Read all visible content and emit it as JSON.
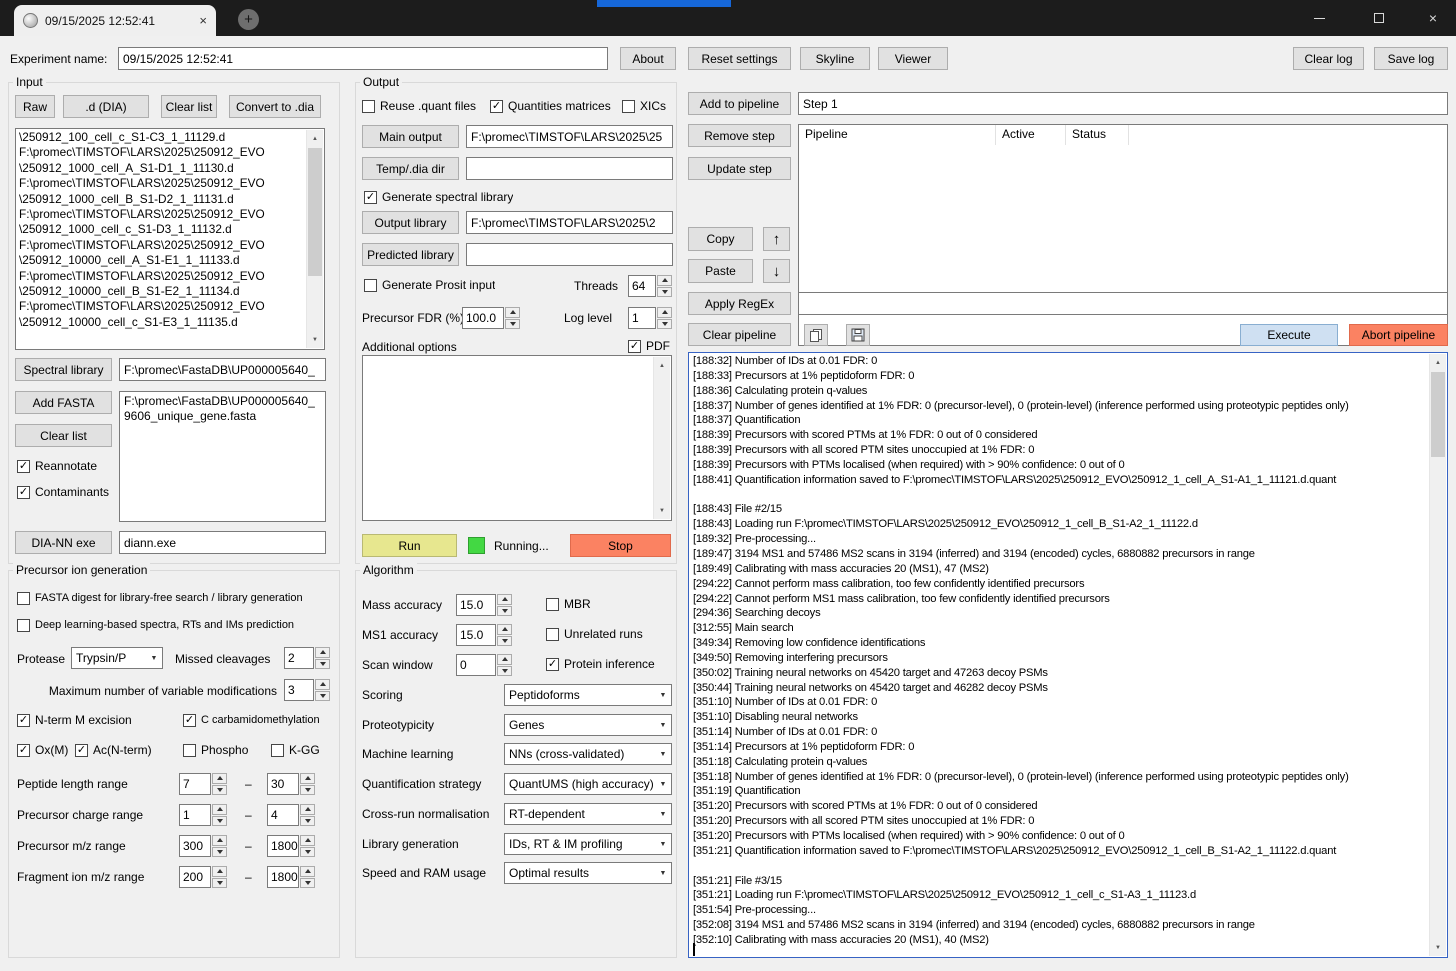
{
  "icons": {
    "dropdown": "▼",
    "check": "✓",
    "plus": "+",
    "close": "×",
    "scroll_up": "▲",
    "scroll_down": "▼",
    "up_arrow": "↑",
    "down_arrow": "↓"
  },
  "colors": {
    "accent_strip": "#1667d9",
    "run_button": "#e7e78f",
    "stop_button": "#fb8262",
    "abort_button": "#fb8262",
    "execute_button": "#cfe0f2",
    "running_indicator": "#43d843",
    "log_focus_border": "#3763c4"
  },
  "titlebar": {
    "tab_title": "09/15/2025 12:52:41"
  },
  "header": {
    "experiment_label": "Experiment name:",
    "experiment_value": "09/15/2025 12:52:41",
    "about": "About",
    "reset_settings": "Reset settings",
    "skyline": "Skyline",
    "viewer": "Viewer",
    "clear_log": "Clear log",
    "save_log": "Save log"
  },
  "input_panel": {
    "title": "Input",
    "raw_btn": "Raw",
    "dia_btn": ".d (DIA)",
    "clear_list_btn": "Clear list",
    "convert_btn": "Convert to .dia",
    "file_lines": [
      "\\250912_100_cell_c_S1-C3_1_11129.d",
      "F:\\promec\\TIMSTOF\\LARS\\2025\\250912_EVO",
      "\\250912_1000_cell_A_S1-D1_1_11130.d",
      "F:\\promec\\TIMSTOF\\LARS\\2025\\250912_EVO",
      "\\250912_1000_cell_B_S1-D2_1_11131.d",
      "F:\\promec\\TIMSTOF\\LARS\\2025\\250912_EVO",
      "\\250912_1000_cell_c_S1-D3_1_11132.d",
      "F:\\promec\\TIMSTOF\\LARS\\2025\\250912_EVO",
      "\\250912_10000_cell_A_S1-E1_1_11133.d",
      "F:\\promec\\TIMSTOF\\LARS\\2025\\250912_EVO",
      "\\250912_10000_cell_B_S1-E2_1_11134.d",
      "F:\\promec\\TIMSTOF\\LARS\\2025\\250912_EVO",
      "\\250912_10000_cell_c_S1-E3_1_11135.d"
    ],
    "spectral_library_btn": "Spectral library",
    "spectral_library_path": "F:\\promec\\FastaDB\\UP000005640_",
    "add_fasta_btn": "Add FASTA",
    "fasta_text": "F:\\promec\\FastaDB\\UP000005640_9606_unique_gene.fasta",
    "clear_fasta_btn": "Clear list",
    "reannotate": {
      "label": "Reannotate",
      "checked": true
    },
    "contaminants": {
      "label": "Contaminants",
      "checked": true
    },
    "diann_exe_btn": "DIA-NN exe",
    "diann_exe_value": "diann.exe"
  },
  "precursor_panel": {
    "title": "Precursor ion generation",
    "fasta_digest": {
      "label": "FASTA digest for library-free search / library generation",
      "checked": false
    },
    "deep_learning": {
      "label": "Deep learning-based spectra, RTs and IMs prediction",
      "checked": false
    },
    "protease_label": "Protease",
    "protease_value": "Trypsin/P",
    "missed_cleavages_label": "Missed cleavages",
    "missed_cleavages_value": "2",
    "max_var_mods_label": "Maximum number of variable modifications",
    "max_var_mods_value": "3",
    "nterm_m": {
      "label": "N-term M excision",
      "checked": true
    },
    "carbamido": {
      "label": "C carbamidomethylation",
      "checked": true
    },
    "oxm": {
      "label": "Ox(M)",
      "checked": true
    },
    "acnterm": {
      "label": "Ac(N-term)",
      "checked": true
    },
    "phospho": {
      "label": "Phospho",
      "checked": false
    },
    "kgg": {
      "label": "K-GG",
      "checked": false
    },
    "dash": "–",
    "peptide_len": {
      "label": "Peptide length range",
      "from": "7",
      "to": "30"
    },
    "charge": {
      "label": "Precursor charge range",
      "from": "1",
      "to": "4"
    },
    "mz": {
      "label": "Precursor m/z range",
      "from": "300",
      "to": "1800"
    },
    "fragment_mz": {
      "label": "Fragment ion m/z range",
      "from": "200",
      "to": "1800"
    }
  },
  "output_panel": {
    "title": "Output",
    "reuse_quant": {
      "label": "Reuse .quant files",
      "checked": false
    },
    "quant_matrices": {
      "label": "Quantities matrices",
      "checked": true
    },
    "xics": {
      "label": "XICs",
      "checked": false
    },
    "main_output_btn": "Main output",
    "main_output_value": "F:\\promec\\TIMSTOF\\LARS\\2025\\25",
    "temp_dir_btn": "Temp/.dia dir",
    "temp_dir_value": "",
    "gen_spec_lib": {
      "label": "Generate spectral library",
      "checked": true
    },
    "output_library_btn": "Output library",
    "output_library_value": "F:\\promec\\TIMSTOF\\LARS\\2025\\2",
    "predicted_library_btn": "Predicted library",
    "predicted_library_value": "",
    "gen_prosit": {
      "label": "Generate Prosit input",
      "checked": false
    },
    "threads_label": "Threads",
    "threads_value": "64",
    "fdr_label": "Precursor FDR (%)",
    "fdr_value": "100.0",
    "log_level_label": "Log level",
    "log_level_value": "1",
    "additional_options_label": "Additional options",
    "pdf": {
      "label": "PDF",
      "checked": true
    },
    "additional_options_value": "",
    "run_btn": "Run",
    "running_label": "Running...",
    "stop_btn": "Stop"
  },
  "algorithm_panel": {
    "title": "Algorithm",
    "mass_accuracy_label": "Mass accuracy",
    "mass_accuracy_value": "15.0",
    "mbr": {
      "label": "MBR",
      "checked": false
    },
    "ms1_accuracy_label": "MS1 accuracy",
    "ms1_accuracy_value": "15.0",
    "unrelated": {
      "label": "Unrelated runs",
      "checked": false
    },
    "scan_window_label": "Scan window",
    "scan_window_value": "0",
    "protein_inference": {
      "label": "Protein inference",
      "checked": true
    },
    "rows": [
      {
        "label": "Scoring",
        "value": "Peptidoforms"
      },
      {
        "label": "Proteotypicity",
        "value": "Genes"
      },
      {
        "label": "Machine learning",
        "value": "NNs (cross-validated)"
      },
      {
        "label": "Quantification strategy",
        "value": "QuantUMS (high accuracy)"
      },
      {
        "label": "Cross-run normalisation",
        "value": "RT-dependent"
      },
      {
        "label": "Library generation",
        "value": "IDs, RT & IM profiling"
      },
      {
        "label": "Speed and RAM usage",
        "value": "Optimal results"
      }
    ]
  },
  "pipeline_panel": {
    "add_btn": "Add to pipeline",
    "step_value": "Step 1",
    "remove_btn": "Remove step",
    "update_btn": "Update step",
    "columns": [
      "Pipeline",
      "Active",
      "Status"
    ],
    "copy_btn": "Copy",
    "paste_btn": "Paste",
    "apply_regex_btn": "Apply RegEx",
    "regex_value": "",
    "clear_btn": "Clear pipeline",
    "execute_btn": "Execute",
    "abort_btn": "Abort pipeline"
  },
  "log": {
    "lines": [
      "[188:32] Number of IDs at 0.01 FDR: 0",
      "[188:33] Precursors at 1% peptidoform FDR: 0",
      "[188:36] Calculating protein q-values",
      "[188:37] Number of genes identified at 1% FDR: 0 (precursor-level), 0 (protein-level) (inference performed using proteotypic peptides only)",
      "[188:37] Quantification",
      "[188:39] Precursors with scored PTMs at 1% FDR: 0 out of 0 considered",
      "[188:39] Precursors with all scored PTM sites unoccupied at 1% FDR: 0",
      "[188:39] Precursors with PTMs localised (when required) with > 90% confidence: 0 out of 0",
      "[188:41] Quantification information saved to F:\\promec\\TIMSTOF\\LARS\\2025\\250912_EVO\\250912_1_cell_A_S1-A1_1_11121.d.quant",
      "",
      "[188:43] File #2/15",
      "[188:43] Loading run F:\\promec\\TIMSTOF\\LARS\\2025\\250912_EVO\\250912_1_cell_B_S1-A2_1_11122.d",
      "[189:32] Pre-processing...",
      "[189:47] 3194 MS1 and 57486 MS2 scans in 3194 (inferred) and 3194 (encoded) cycles, 6880882 precursors in range",
      "[189:49] Calibrating with mass accuracies 20 (MS1), 47 (MS2)",
      "[294:22] Cannot perform mass calibration, too few confidently identified precursors",
      "[294:22] Cannot perform MS1 mass calibration, too few confidently identified precursors",
      "[294:36] Searching decoys",
      "[312:55] Main search",
      "[349:34] Removing low confidence identifications",
      "[349:50] Removing interfering precursors",
      "[350:02] Training neural networks on 45420 target and 47263 decoy PSMs",
      "[350:44] Training neural networks on 45420 target and 46282 decoy PSMs",
      "[351:10] Number of IDs at 0.01 FDR: 0",
      "[351:10] Disabling neural networks",
      "[351:14] Number of IDs at 0.01 FDR: 0",
      "[351:14] Precursors at 1% peptidoform FDR: 0",
      "[351:18] Calculating protein q-values",
      "[351:18] Number of genes identified at 1% FDR: 0 (precursor-level), 0 (protein-level) (inference performed using proteotypic peptides only)",
      "[351:19] Quantification",
      "[351:20] Precursors with scored PTMs at 1% FDR: 0 out of 0 considered",
      "[351:20] Precursors with all scored PTM sites unoccupied at 1% FDR: 0",
      "[351:20] Precursors with PTMs localised (when required) with > 90% confidence: 0 out of 0",
      "[351:21] Quantification information saved to F:\\promec\\TIMSTOF\\LARS\\2025\\250912_EVO\\250912_1_cell_B_S1-A2_1_11122.d.quant",
      "",
      "[351:21] File #3/15",
      "[351:21] Loading run F:\\promec\\TIMSTOF\\LARS\\2025\\250912_EVO\\250912_1_cell_c_S1-A3_1_11123.d",
      "[351:54] Pre-processing...",
      "[352:08] 3194 MS1 and 57486 MS2 scans in 3194 (inferred) and 3194 (encoded) cycles, 6880882 precursors in range",
      "[352:10] Calibrating with mass accuracies 20 (MS1), 40 (MS2)"
    ]
  }
}
